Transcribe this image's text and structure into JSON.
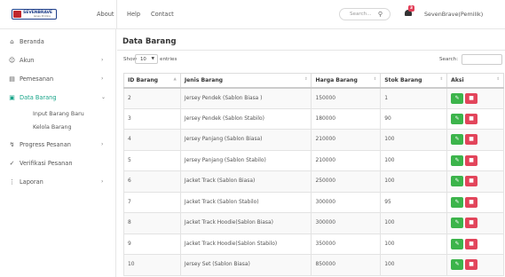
{
  "header": {
    "logo_text": "SEVENBRAVE",
    "logo_sub": "Jersey Printing",
    "about": "About",
    "nav": [
      "Help",
      "Contact"
    ],
    "search_placeholder": "Search...",
    "notification_count": "3",
    "user": "SevenBrave(Pemilik)"
  },
  "sidebar": {
    "items": [
      {
        "label": "Beranda",
        "icon": "home-icon"
      },
      {
        "label": "Akun",
        "icon": "user-icon",
        "has_children": true
      },
      {
        "label": "Pemesanan",
        "icon": "cart-icon",
        "has_children": true
      },
      {
        "label": "Data Barang",
        "icon": "box-icon",
        "has_children": true,
        "active": true
      },
      {
        "label": "Progress Pesanan",
        "icon": "progress-icon",
        "has_children": true
      },
      {
        "label": "Verifikasi Pesanan",
        "icon": "check-icon"
      },
      {
        "label": "Laporan",
        "icon": "report-icon",
        "has_children": true
      }
    ],
    "subitems": [
      "Input Barang Baru",
      "Kelola Barang"
    ],
    "accent": "#1aa58a"
  },
  "main": {
    "title": "Data Barang",
    "show_label": "Show",
    "show_value": "10",
    "entries_label": "entries",
    "search_label": "Search:",
    "columns": [
      "ID Barang",
      "Jenis Barang",
      "Harga Barang",
      "Stok Barang",
      "Aksi"
    ],
    "rows": [
      {
        "id": "2",
        "jenis": "Jersey Pendek (Sablon Biasa )",
        "harga": "150000",
        "stok": "1"
      },
      {
        "id": "3",
        "jenis": "Jersey Pendek (Sablon Stabilo)",
        "harga": "180000",
        "stok": "90"
      },
      {
        "id": "4",
        "jenis": "Jersey Panjang (Sablon Biasa)",
        "harga": "210000",
        "stok": "100"
      },
      {
        "id": "5",
        "jenis": "Jersey Panjang (Sablon Stabilo)",
        "harga": "210000",
        "stok": "100"
      },
      {
        "id": "6",
        "jenis": "Jacket Track (Sablon Biasa)",
        "harga": "250000",
        "stok": "100"
      },
      {
        "id": "7",
        "jenis": "Jacket Track (Sablon Stabilo)",
        "harga": "300000",
        "stok": "95"
      },
      {
        "id": "8",
        "jenis": "Jacket Track Hoodie(Sablon Biasa)",
        "harga": "300000",
        "stok": "100"
      },
      {
        "id": "9",
        "jenis": "Jacket Track Hoodie(Sablon Stabilo)",
        "harga": "350000",
        "stok": "100"
      },
      {
        "id": "10",
        "jenis": "Jersey Set (Sablon Biasa)",
        "harga": "850000",
        "stok": "100"
      }
    ],
    "edit_color": "#3cb44b",
    "delete_color": "#e2455b"
  }
}
